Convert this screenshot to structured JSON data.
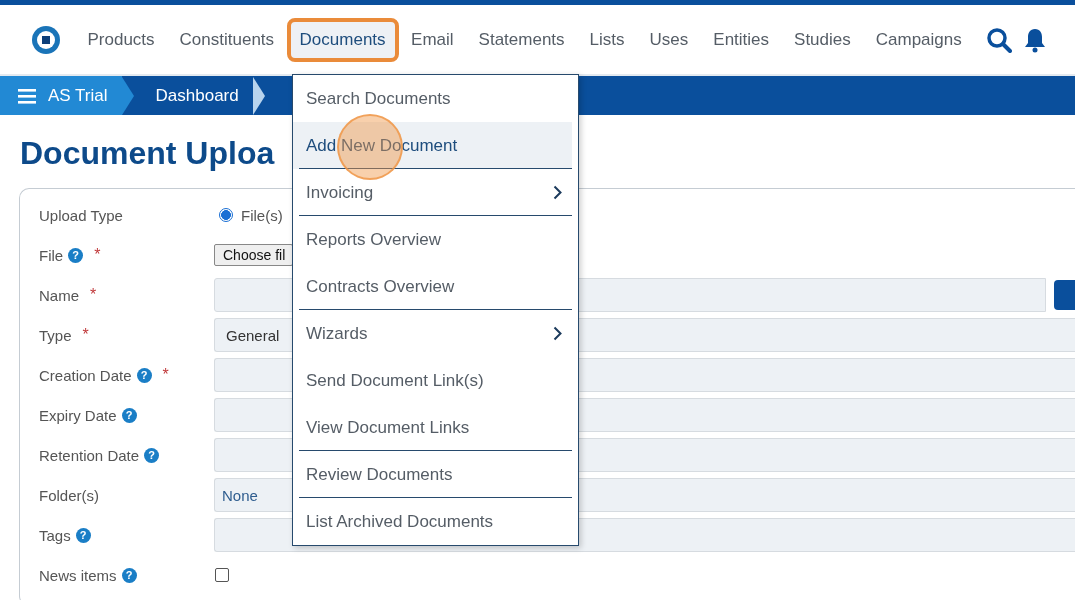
{
  "nav": {
    "items": [
      {
        "label": "Products",
        "selected": false
      },
      {
        "label": "Constituents",
        "selected": false
      },
      {
        "label": "Documents",
        "selected": true
      },
      {
        "label": "Email",
        "selected": false
      },
      {
        "label": "Statements",
        "selected": false
      },
      {
        "label": "Lists",
        "selected": false
      },
      {
        "label": "Uses",
        "selected": false
      },
      {
        "label": "Entities",
        "selected": false
      },
      {
        "label": "Studies",
        "selected": false
      },
      {
        "label": "Campaigns",
        "selected": false
      }
    ]
  },
  "breadcrumbs": [
    "AS Trial",
    "Dashboard"
  ],
  "page_title": "Document Uploa",
  "form": {
    "rows": [
      {
        "kind": "radio",
        "label": "Upload Type",
        "option": "File(s)",
        "checked": true
      },
      {
        "kind": "file",
        "label": "File",
        "help": "?",
        "required": "*",
        "button": "Choose fil"
      },
      {
        "kind": "text",
        "label": "Name",
        "required": "*",
        "action": true
      },
      {
        "kind": "text",
        "label": "Type",
        "required": "*",
        "value": "General"
      },
      {
        "kind": "text",
        "label": "Creation Date",
        "help": "?",
        "required": "*"
      },
      {
        "kind": "text",
        "label": "Expiry Date",
        "help": "?"
      },
      {
        "kind": "text",
        "label": "Retention Date",
        "help": "?"
      },
      {
        "kind": "text",
        "label": "Folder(s)",
        "value": "None"
      },
      {
        "kind": "text",
        "label": "Tags",
        "help": "?"
      },
      {
        "kind": "checkbox",
        "label": "News items",
        "help": "?",
        "checked": false
      }
    ]
  },
  "menu": {
    "items": [
      {
        "label": "Search Documents",
        "kind": "item",
        "selected": false,
        "divider_after": false
      },
      {
        "label": "Add New Document",
        "kind": "item",
        "selected": true,
        "divider_after": true
      },
      {
        "label": "Invoicing",
        "kind": "submenu",
        "selected": false,
        "divider_after": true
      },
      {
        "label": "Reports Overview",
        "kind": "item",
        "selected": false,
        "divider_after": false
      },
      {
        "label": "Contracts Overview",
        "kind": "item",
        "selected": false,
        "divider_after": true
      },
      {
        "label": "Wizards",
        "kind": "submenu",
        "selected": false,
        "divider_after": false
      },
      {
        "label": "Send Document Link(s)",
        "kind": "item",
        "selected": false,
        "divider_after": false
      },
      {
        "label": "View Document Links",
        "kind": "item",
        "selected": false,
        "divider_after": true
      },
      {
        "label": "Review Documents",
        "kind": "item",
        "selected": false,
        "divider_after": true
      },
      {
        "label": "List Archived Documents",
        "kind": "item",
        "selected": false,
        "divider_after": false
      }
    ]
  }
}
